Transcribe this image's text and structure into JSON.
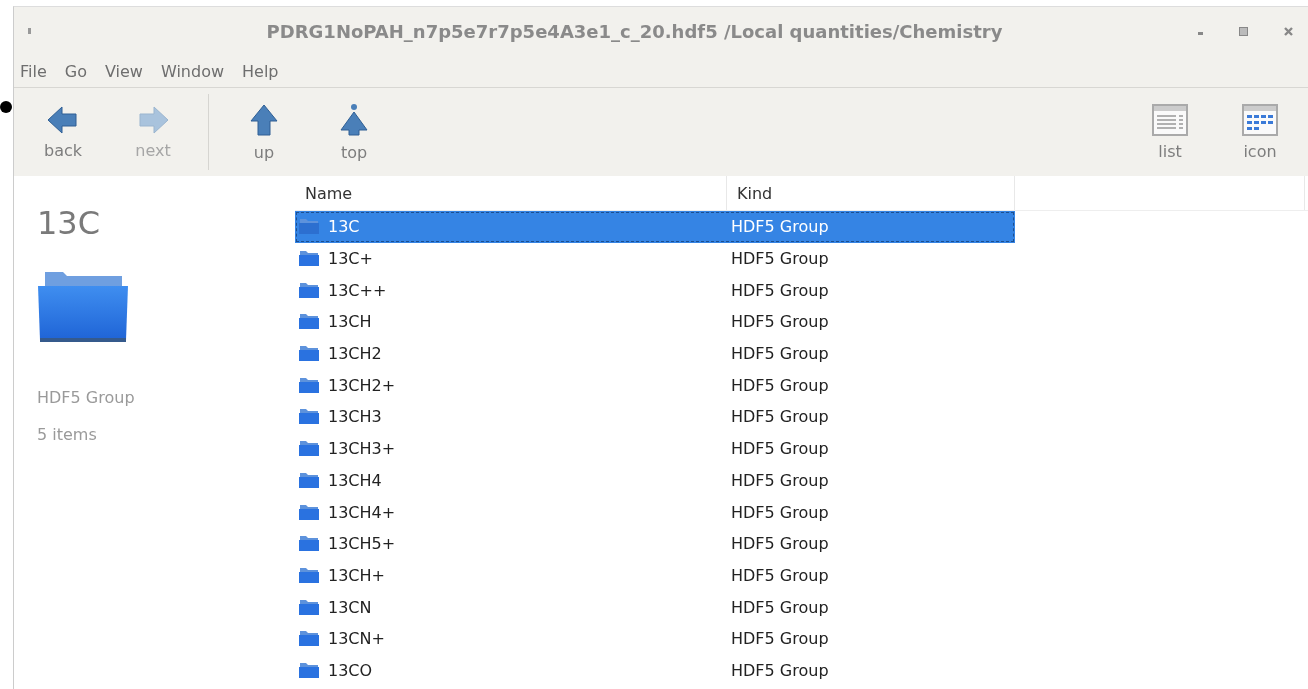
{
  "window": {
    "title": "PDRG1NoPAH_n7p5e7r7p5e4A3e1_c_20.hdf5 /Local quantities/Chemistry"
  },
  "menu": [
    "File",
    "Go",
    "View",
    "Window",
    "Help"
  ],
  "toolbar": {
    "nav": [
      {
        "kind": "back",
        "label": "back",
        "disabled": false
      },
      {
        "kind": "next",
        "label": "next",
        "disabled": true
      },
      {
        "kind": "up",
        "label": "up",
        "disabled": false
      },
      {
        "kind": "top",
        "label": "top",
        "disabled": false
      }
    ],
    "views": [
      {
        "kind": "list",
        "label": "list"
      },
      {
        "kind": "icon",
        "label": "icon"
      }
    ]
  },
  "details": {
    "name": "13C",
    "kind": "HDF5 Group",
    "count": "5 items"
  },
  "table": {
    "columns": [
      "Name",
      "Kind"
    ],
    "rows": [
      {
        "name": "13C",
        "kind": "HDF5 Group",
        "selected": true
      },
      {
        "name": "13C+",
        "kind": "HDF5 Group",
        "selected": false
      },
      {
        "name": "13C++",
        "kind": "HDF5 Group",
        "selected": false
      },
      {
        "name": "13CH",
        "kind": "HDF5 Group",
        "selected": false
      },
      {
        "name": "13CH2",
        "kind": "HDF5 Group",
        "selected": false
      },
      {
        "name": "13CH2+",
        "kind": "HDF5 Group",
        "selected": false
      },
      {
        "name": "13CH3",
        "kind": "HDF5 Group",
        "selected": false
      },
      {
        "name": "13CH3+",
        "kind": "HDF5 Group",
        "selected": false
      },
      {
        "name": "13CH4",
        "kind": "HDF5 Group",
        "selected": false
      },
      {
        "name": "13CH4+",
        "kind": "HDF5 Group",
        "selected": false
      },
      {
        "name": "13CH5+",
        "kind": "HDF5 Group",
        "selected": false
      },
      {
        "name": "13CH+",
        "kind": "HDF5 Group",
        "selected": false
      },
      {
        "name": "13CN",
        "kind": "HDF5 Group",
        "selected": false
      },
      {
        "name": "13CN+",
        "kind": "HDF5 Group",
        "selected": false
      },
      {
        "name": "13CO",
        "kind": "HDF5 Group",
        "selected": false
      }
    ]
  }
}
